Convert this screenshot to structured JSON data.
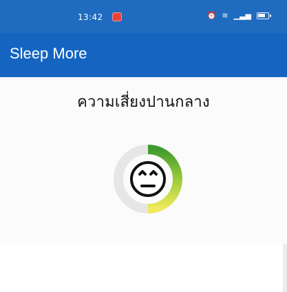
{
  "status_bar": {
    "time": "13:42",
    "recording_indicator_icon": "record-icon",
    "icons": [
      "alarm-icon",
      "wifi-icon",
      "signal-icon",
      "battery-icon"
    ],
    "battery_level": "67"
  },
  "app_bar": {
    "title": "Sleep More"
  },
  "main": {
    "risk_label": "ความเสี่ยงปานกลาง",
    "gauge_icon": "neutral-face-icon"
  },
  "colors": {
    "status_bar": "#1f6bbf",
    "app_bar": "#1565c0",
    "gauge_track": "#e6e6e6",
    "gauge_green": "#3f9b2e",
    "gauge_lime": "#a7c935",
    "gauge_yellow": "#ece74b",
    "face_stroke": "#111111"
  }
}
